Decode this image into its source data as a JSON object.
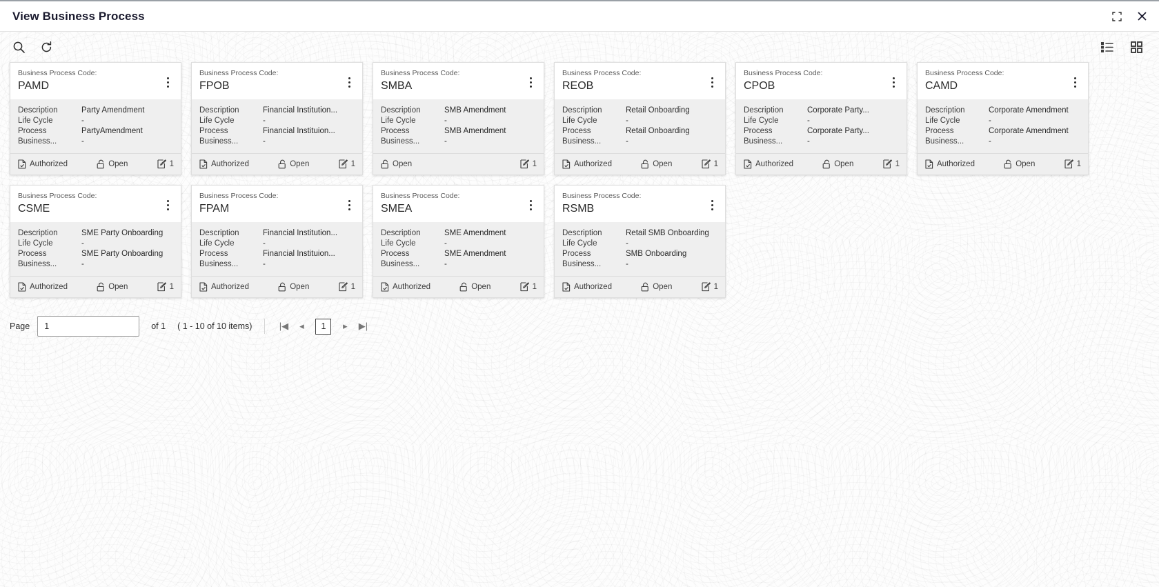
{
  "window": {
    "title": "View Business Process",
    "restore_icon": "restore-icon",
    "close_icon": "close-icon"
  },
  "toolbar": {
    "search_icon": "search-icon",
    "refresh_icon": "refresh-icon",
    "list_view_icon": "list-view-icon",
    "grid_view_icon": "grid-view-icon"
  },
  "card_labels": {
    "code_label": "Business Process Code:",
    "description": "Description",
    "life_cycle": "Life Cycle",
    "process": "Process",
    "business": "Business...",
    "kebab_icon": "more-options-icon",
    "authorized_icon": "authorized-doc-icon",
    "open_icon": "unlocked-padlock-icon",
    "edit_icon": "edit-count-icon"
  },
  "cards": [
    {
      "code": "PAMD",
      "description": "Party Amendment",
      "life_cycle": "-",
      "process": "PartyAmendment",
      "business": "-",
      "status": "Authorized",
      "lock": "Open",
      "count": "1"
    },
    {
      "code": "FPOB",
      "description": "Financial Institution...",
      "life_cycle": "-",
      "process": "Financial Instituion...",
      "business": "-",
      "status": "Authorized",
      "lock": "Open",
      "count": "1"
    },
    {
      "code": "SMBA",
      "description": "SMB Amendment",
      "life_cycle": "-",
      "process": "SMB Amendment",
      "business": "-",
      "status": "",
      "lock": "Open",
      "count": "1"
    },
    {
      "code": "REOB",
      "description": "Retail Onboarding",
      "life_cycle": "-",
      "process": "Retail Onboarding",
      "business": "-",
      "status": "Authorized",
      "lock": "Open",
      "count": "1"
    },
    {
      "code": "CPOB",
      "description": "Corporate Party...",
      "life_cycle": "-",
      "process": "Corporate Party...",
      "business": "-",
      "status": "Authorized",
      "lock": "Open",
      "count": "1"
    },
    {
      "code": "CAMD",
      "description": "Corporate Amendment",
      "life_cycle": "-",
      "process": "Corporate Amendment",
      "business": "-",
      "status": "Authorized",
      "lock": "Open",
      "count": "1"
    },
    {
      "code": "CSME",
      "description": "SME Party Onboarding",
      "life_cycle": "-",
      "process": "SME Party Onboarding",
      "business": "-",
      "status": "Authorized",
      "lock": "Open",
      "count": "1"
    },
    {
      "code": "FPAM",
      "description": "Financial Institution...",
      "life_cycle": "-",
      "process": "Financial Instituion...",
      "business": "-",
      "status": "Authorized",
      "lock": "Open",
      "count": "1"
    },
    {
      "code": "SMEA",
      "description": "SME Amendment",
      "life_cycle": "-",
      "process": "SME Amendment",
      "business": "-",
      "status": "Authorized",
      "lock": "Open",
      "count": "1"
    },
    {
      "code": "RSMB",
      "description": "Retail SMB Onboarding",
      "life_cycle": "-",
      "process": "SMB Onboarding",
      "business": "-",
      "status": "Authorized",
      "lock": "Open",
      "count": "1"
    }
  ],
  "pagination": {
    "page_label": "Page",
    "page_value": "1",
    "of_text": "of 1",
    "items_text": "( 1 - 10 of 10 items)",
    "first_label": "|◀",
    "prev_label": "◂",
    "current_page": "1",
    "next_label": "▸",
    "last_label": "▶|"
  }
}
